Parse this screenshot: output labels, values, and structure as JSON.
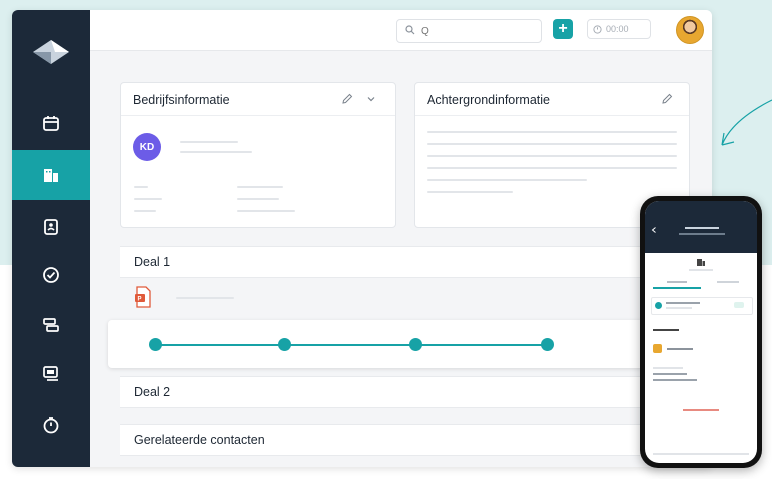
{
  "colors": {
    "accent": "#17a2a6",
    "sidebar": "#1c2939",
    "avatar_initials_bg": "#6c5ce7",
    "attachment_icon": "#e05a3a"
  },
  "topbar": {
    "search_placeholder": "Q",
    "add_label": "+",
    "timer_value": "00:00"
  },
  "sidebar": {
    "items": [
      {
        "icon": "calendar-icon",
        "active": false
      },
      {
        "icon": "companies-icon",
        "active": true
      },
      {
        "icon": "contacts-icon",
        "active": false
      },
      {
        "icon": "tasks-check-icon",
        "active": false
      },
      {
        "icon": "deals-icon",
        "active": false
      },
      {
        "icon": "documents-icon",
        "active": false
      },
      {
        "icon": "timer-icon",
        "active": false
      }
    ]
  },
  "company_card": {
    "title": "Bedrijfsinformatie",
    "initials": "KD"
  },
  "background_card": {
    "title": "Achtergrondinformatie"
  },
  "deals": [
    {
      "label": "Deal 1",
      "stages_completed": 4
    },
    {
      "label": "Deal 2"
    }
  ],
  "related_contacts": {
    "title": "Gerelateerde contacten"
  }
}
